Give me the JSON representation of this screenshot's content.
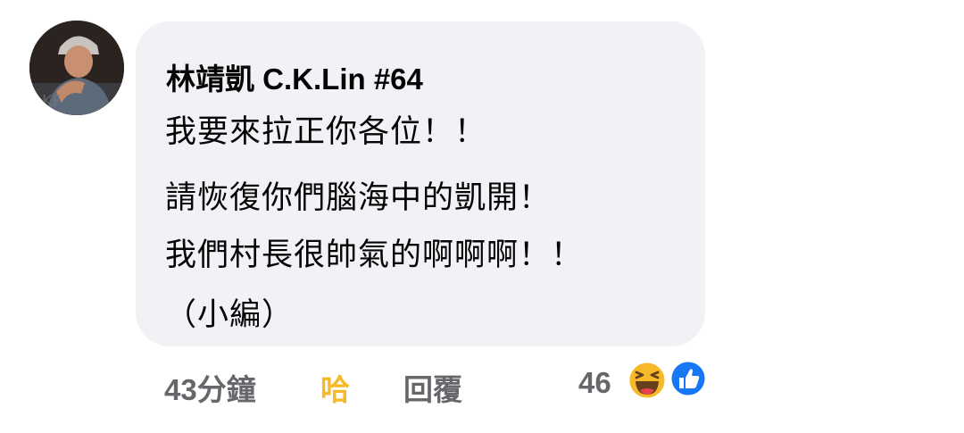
{
  "comment": {
    "author": "林靖凱 C.K.Lin #64",
    "lines": [
      "我要來拉正你各位！！",
      "請恢復你們腦海中的凱開！",
      "我們村長很帥氣的啊啊啊！！",
      "（小編）"
    ]
  },
  "actions": {
    "timestamp": "43分鐘",
    "haha_label": "哈",
    "reply_label": "回覆",
    "reaction_count": "46",
    "reaction_icons": [
      "haha-emoji-icon",
      "like-icon"
    ]
  },
  "colors": {
    "bubble_bg": "#f0f2f5",
    "text": "#050505",
    "meta": "#65676b",
    "haha_active": "#f7b928",
    "like_blue": "#1877f2"
  }
}
